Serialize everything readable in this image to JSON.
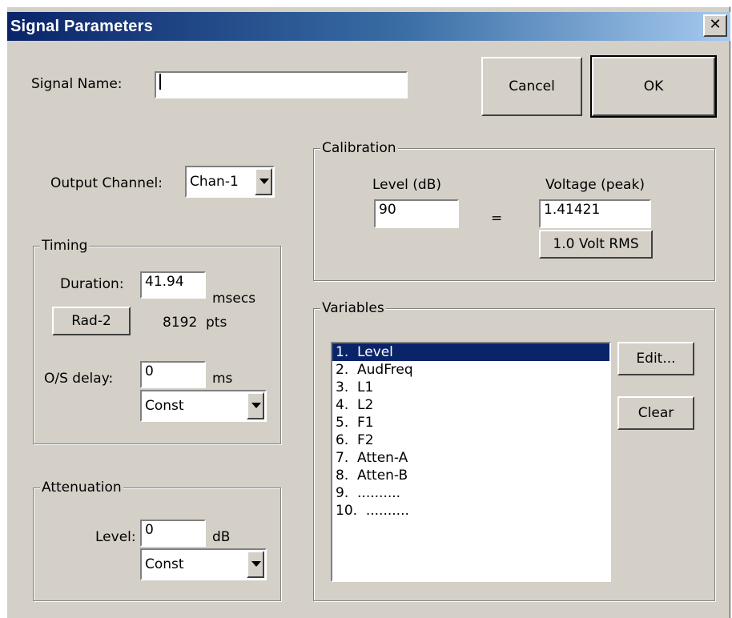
{
  "window": {
    "title": "Signal Parameters",
    "close_glyph": "✕"
  },
  "signal_name": {
    "label": "Signal Name:",
    "value": ""
  },
  "buttons": {
    "cancel": "Cancel",
    "ok": "OK"
  },
  "output_channel": {
    "label": "Output Channel:",
    "selected": "Chan-1"
  },
  "timing": {
    "legend": "Timing",
    "duration_label": "Duration:",
    "duration_value": "41.94",
    "duration_unit": "msecs",
    "rad2_button": "Rad-2",
    "points": "8192",
    "points_unit": "pts",
    "os_delay_label": "O/S delay:",
    "os_delay_value": "0",
    "os_delay_unit": "ms",
    "mode_selected": "Const"
  },
  "attenuation": {
    "legend": "Attenuation",
    "level_label": "Level:",
    "level_value": "0",
    "level_unit": "dB",
    "mode_selected": "Const"
  },
  "calibration": {
    "legend": "Calibration",
    "level_label": "Level (dB)",
    "level_value": "90",
    "equals": "=",
    "voltage_label": "Voltage (peak)",
    "voltage_value": "1.41421",
    "rms_button": "1.0 Volt RMS"
  },
  "variables": {
    "legend": "Variables",
    "items": [
      "1.  Level",
      "2.  AudFreq",
      "3.  L1",
      "4.  L2",
      "5.  F1",
      "6.  F2",
      "7.  Atten-A",
      "8.  Atten-B",
      "9.  ..........",
      "10.  .........."
    ],
    "selected_index": 0,
    "edit_button": "Edit...",
    "clear_button": "Clear"
  },
  "colors": {
    "face": "#d4d0c8",
    "title_start": "#0a246a",
    "title_end": "#a6caf0",
    "selection": "#0a246a"
  }
}
